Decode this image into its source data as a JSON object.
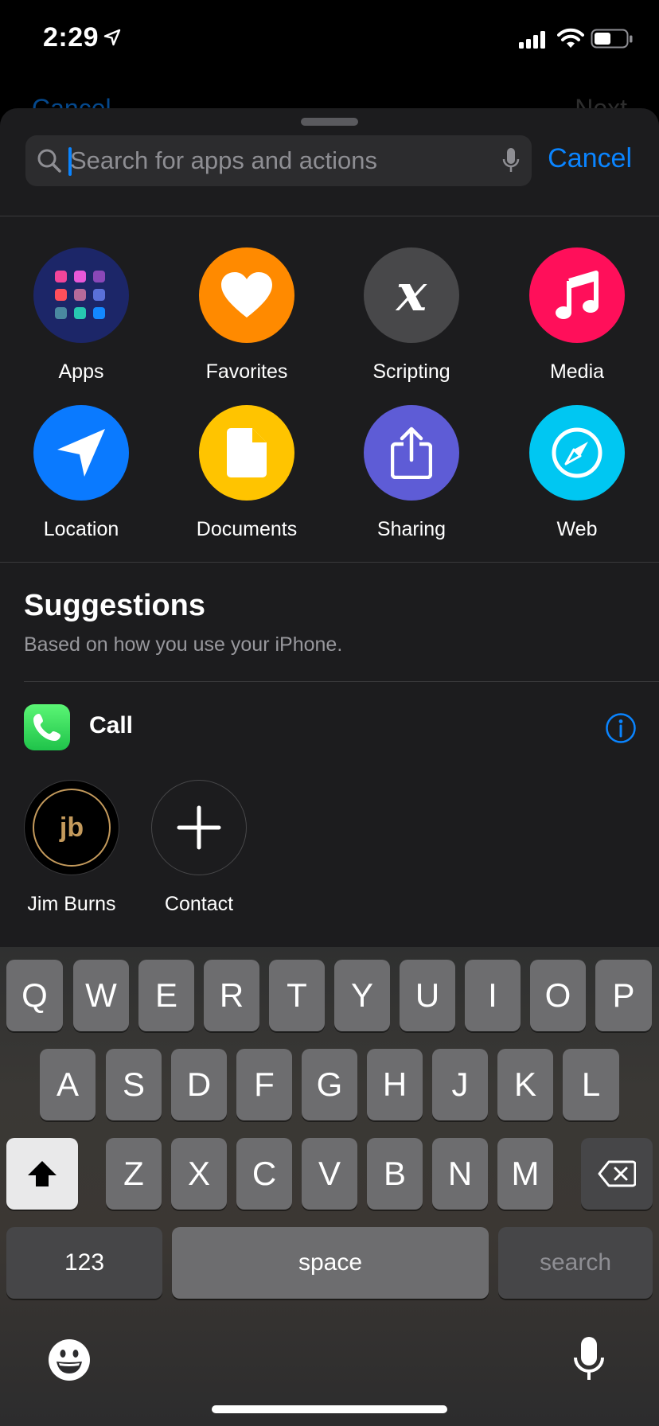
{
  "status_bar": {
    "time": "2:29"
  },
  "behind_nav": {
    "left_label": "Cancel",
    "right_label": "Next"
  },
  "search": {
    "placeholder": "Search for apps and actions",
    "value": "",
    "cancel_label": "Cancel"
  },
  "categories": [
    {
      "label": "Apps",
      "icon": "apps-grid-icon",
      "color": "#1c2668"
    },
    {
      "label": "Favorites",
      "icon": "heart-icon",
      "color": "#ff8a00"
    },
    {
      "label": "Scripting",
      "icon": "scripting-x-icon",
      "color": "#48484a"
    },
    {
      "label": "Media",
      "icon": "music-note-icon",
      "color": "#ff0f5a"
    },
    {
      "label": "Location",
      "icon": "location-arrow-icon",
      "color": "#0a7aff"
    },
    {
      "label": "Documents",
      "icon": "document-icon",
      "color": "#ffc400"
    },
    {
      "label": "Sharing",
      "icon": "share-icon",
      "color": "#5e5cd6"
    },
    {
      "label": "Web",
      "icon": "compass-icon",
      "color": "#00c7f2"
    }
  ],
  "suggestions": {
    "title": "Suggestions",
    "subtitle": "Based on how you use your iPhone.",
    "call": {
      "label": "Call",
      "contacts": [
        {
          "name": "Jim Burns",
          "initials": "jb"
        },
        {
          "name": "Contact"
        }
      ]
    }
  },
  "keyboard": {
    "row1": [
      "Q",
      "W",
      "E",
      "R",
      "T",
      "Y",
      "U",
      "I",
      "O",
      "P"
    ],
    "row2": [
      "A",
      "S",
      "D",
      "F",
      "G",
      "H",
      "J",
      "K",
      "L"
    ],
    "row3": [
      "Z",
      "X",
      "C",
      "V",
      "B",
      "N",
      "M"
    ],
    "numbers_label": "123",
    "space_label": "space",
    "return_label": "search"
  },
  "colors": {
    "accent": "#0a84ff",
    "sheet_bg": "#1c1c1e"
  }
}
